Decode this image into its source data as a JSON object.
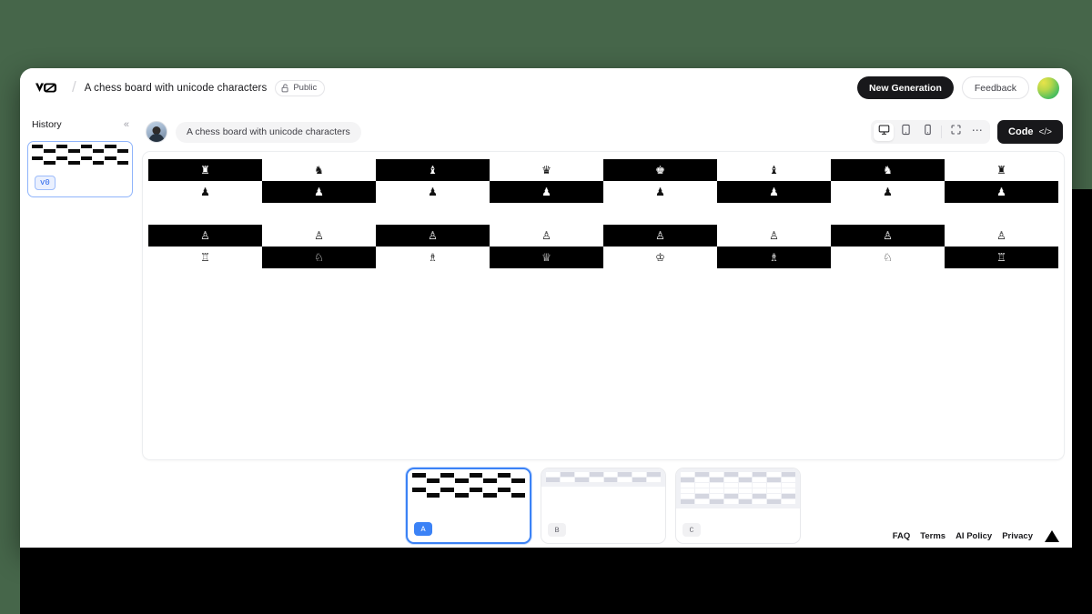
{
  "theme": {
    "backdrop_green": "#46664a",
    "accent_blue": "#3b82f6",
    "dark": "#18181b",
    "board_dark": "#000000",
    "board_light": "#ffffff"
  },
  "topbar": {
    "logo": "v0-logo",
    "separator": "/",
    "project_title": "A chess board with unicode characters",
    "visibility_label": "Public",
    "visibility_icon": "lock-open-icon",
    "new_generation_label": "New Generation",
    "feedback_label": "Feedback",
    "account_avatar": "account-avatar"
  },
  "sidebar": {
    "title": "History",
    "collapse_icon": "«",
    "items": [
      {
        "badge": "v0",
        "selected": true
      }
    ]
  },
  "preview_toolbar": {
    "user_avatar": "user-avatar",
    "prompt_text": "A chess board with unicode characters",
    "viewports": [
      {
        "name": "desktop-view-button",
        "icon": "monitor-icon",
        "active": true
      },
      {
        "name": "tablet-view-button",
        "icon": "tablet-icon",
        "active": false
      },
      {
        "name": "mobile-view-button",
        "icon": "phone-icon",
        "active": false
      },
      {
        "name": "fullscreen-button",
        "icon": "expand-icon",
        "active": false
      },
      {
        "name": "more-options-button",
        "icon": "ellipsis-icon",
        "active": false
      }
    ],
    "code_label": "Code",
    "code_chevrons": "</>"
  },
  "chess_board": {
    "rows": [
      {
        "index": 0,
        "pieces": [
          "♜",
          "♞",
          "♝",
          "♛",
          "♚",
          "♝",
          "♞",
          "♜"
        ],
        "squares": [
          "dark",
          "light",
          "dark",
          "light",
          "dark",
          "light",
          "dark",
          "light"
        ]
      },
      {
        "index": 1,
        "pieces": [
          "♟",
          "♟",
          "♟",
          "♟",
          "♟",
          "♟",
          "♟",
          "♟"
        ],
        "squares": [
          "light",
          "dark",
          "light",
          "dark",
          "light",
          "dark",
          "light",
          "dark"
        ]
      },
      {
        "index": 2,
        "pieces": [
          "♙",
          "♙",
          "♙",
          "♙",
          "♙",
          "♙",
          "♙",
          "♙"
        ],
        "squares": [
          "dark",
          "light",
          "dark",
          "light",
          "dark",
          "light",
          "dark",
          "light"
        ]
      },
      {
        "index": 3,
        "pieces": [
          "♖",
          "♘",
          "♗",
          "♕",
          "♔",
          "♗",
          "♘",
          "♖"
        ],
        "squares": [
          "light",
          "dark",
          "light",
          "dark",
          "light",
          "dark",
          "light",
          "dark"
        ]
      }
    ]
  },
  "variants": [
    {
      "badge": "A",
      "selected": true,
      "style": "mono"
    },
    {
      "badge": "B",
      "selected": false,
      "style": "gray-short"
    },
    {
      "badge": "C",
      "selected": false,
      "style": "gray-tall"
    }
  ],
  "footer": {
    "links": [
      "FAQ",
      "Terms",
      "AI Policy",
      "Privacy"
    ],
    "logo": "vercel-triangle-icon"
  }
}
